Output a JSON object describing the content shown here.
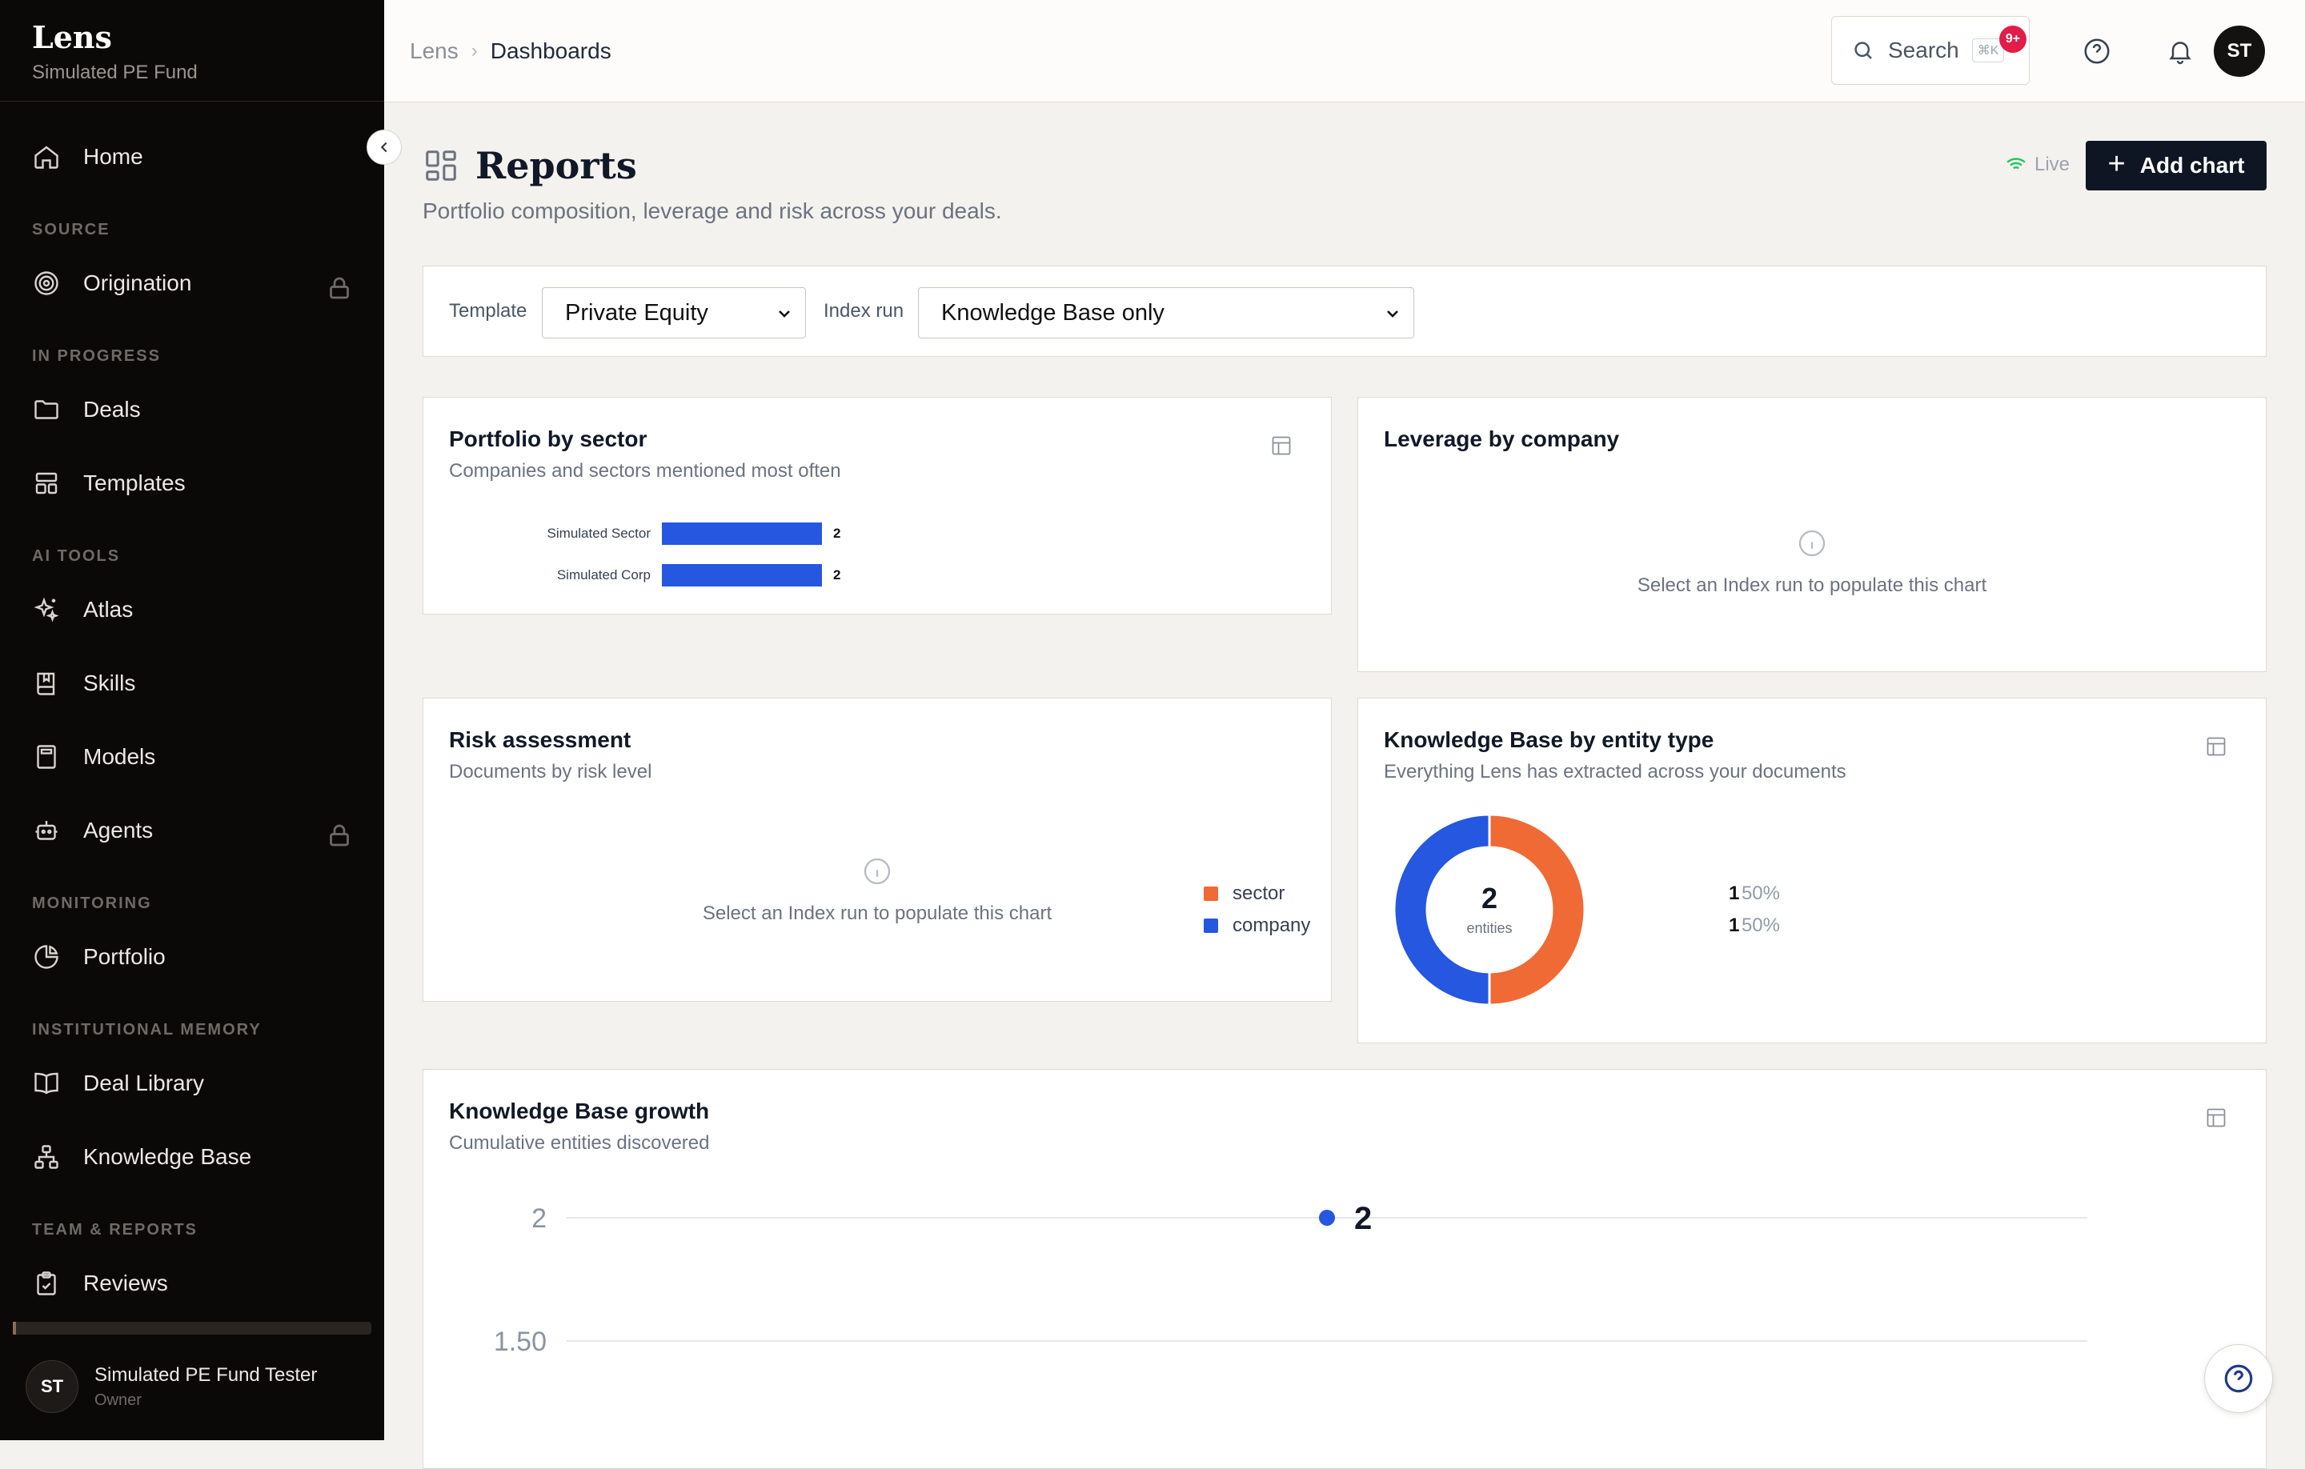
{
  "brand": {
    "name": "Lens",
    "fund": "Simulated PE Fund"
  },
  "sidebar": {
    "home": "Home",
    "sections": {
      "source": "SOURCE",
      "in_progress": "IN PROGRESS",
      "ai_tools": "AI TOOLS",
      "monitoring": "MONITORING",
      "institutional_memory": "INSTITUTIONAL MEMORY",
      "team_reports": "TEAM & REPORTS"
    },
    "items": {
      "origination": "Origination",
      "deals": "Deals",
      "templates": "Templates",
      "atlas": "Atlas",
      "skills": "Skills",
      "models": "Models",
      "agents": "Agents",
      "portfolio": "Portfolio",
      "deal_library": "Deal Library",
      "knowledge_base": "Knowledge Base",
      "reviews": "Reviews"
    },
    "user": {
      "initials": "ST",
      "name": "Simulated PE Fund Tester",
      "role": "Owner"
    }
  },
  "topbar": {
    "breadcrumb": [
      "Lens",
      "Dashboards"
    ],
    "search_label": "Search",
    "search_shortcut": "⌘K",
    "notification_count": "9+",
    "avatar_initials": "ST"
  },
  "page": {
    "title": "Reports",
    "subtitle": "Portfolio composition, leverage and risk across your deals.",
    "live_label": "Live",
    "add_chart_label": "Add chart"
  },
  "filters": {
    "template_label": "Template",
    "template_value": "Private Equity",
    "index_run_label": "Index run",
    "index_run_value": "Knowledge Base only"
  },
  "cards": {
    "portfolio_by_sector": {
      "title": "Portfolio by sector",
      "subtitle": "Companies and sectors mentioned most often"
    },
    "leverage_by_company": {
      "title": "Leverage by company",
      "empty": "Select an Index run to populate this chart"
    },
    "risk_assessment": {
      "title": "Risk assessment",
      "subtitle": "Documents by risk level",
      "empty": "Select an Index run to populate this chart"
    },
    "kb_by_entity_type": {
      "title": "Knowledge Base by entity type",
      "subtitle": "Everything Lens has extracted across your documents",
      "center_value": "2",
      "center_label": "entities"
    },
    "kb_growth": {
      "title": "Knowledge Base growth",
      "subtitle": "Cumulative entities discovered",
      "point_label": "2"
    }
  },
  "colors": {
    "blue": "#2557e0",
    "orange": "#ef6a35",
    "live_green": "#22c55e",
    "dark": "#0f1623"
  },
  "chart_data": [
    {
      "type": "bar",
      "orientation": "horizontal",
      "title": "Portfolio by sector",
      "categories": [
        "Simulated Sector",
        "Simulated Corp"
      ],
      "values": [
        2,
        2
      ]
    },
    {
      "type": "pie",
      "title": "Knowledge Base by entity type",
      "categories": [
        "sector",
        "company"
      ],
      "values": [
        1,
        1
      ],
      "percents": [
        "50%",
        "50%"
      ],
      "colors": [
        "#ef6a35",
        "#2557e0"
      ]
    },
    {
      "type": "line",
      "title": "Knowledge Base growth",
      "ylabel_ticks": [
        "2",
        "1.50"
      ],
      "y_ticks": [
        2,
        1.5
      ],
      "series": [
        {
          "values": [
            2
          ]
        }
      ]
    }
  ]
}
